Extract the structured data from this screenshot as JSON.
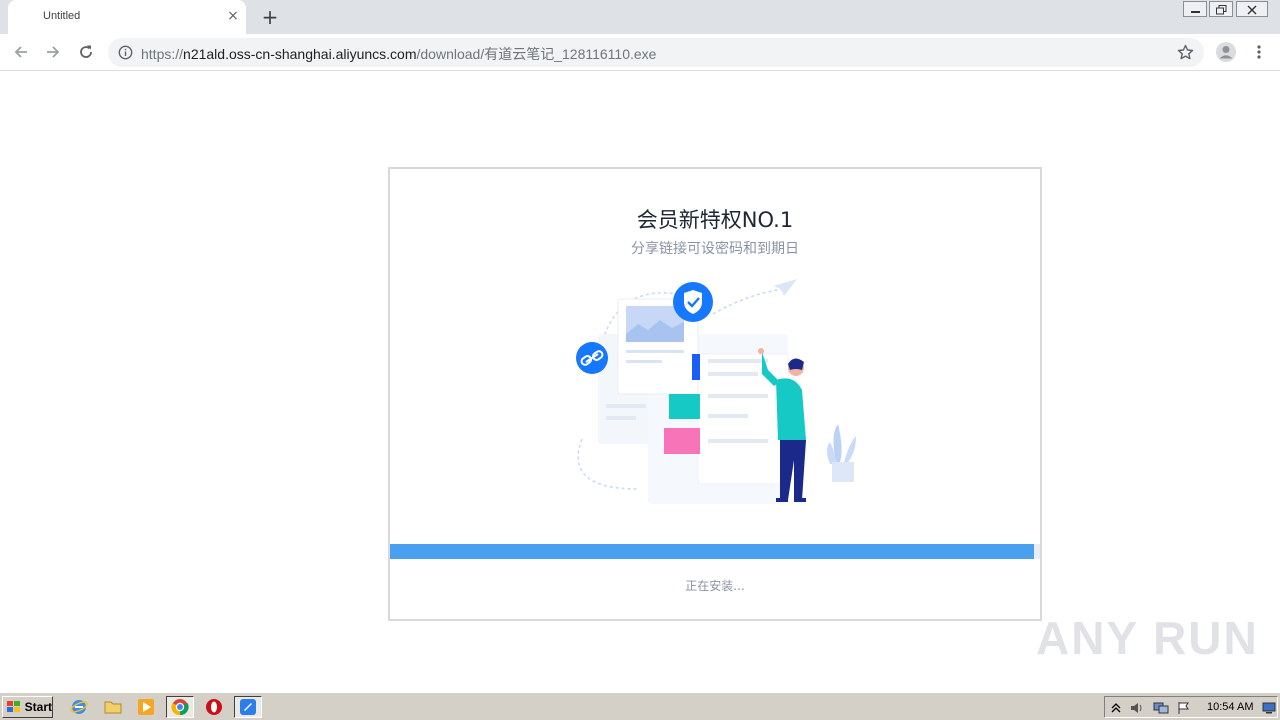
{
  "browser": {
    "tab": {
      "title": "Untitled",
      "close_glyph": "×"
    },
    "new_tab_glyph": "+",
    "address": {
      "scheme": "https://",
      "host": "n21ald.oss-cn-shanghai.aliyuncs.com",
      "path": "/download/有道云笔记_128116110.exe"
    }
  },
  "installer": {
    "title": "会员新特权NO.1",
    "subtitle": "分享链接可设密码和到期日",
    "progress_percent": 99,
    "status": "正在安装...",
    "colors": {
      "accent": "#4a9ff1",
      "shield": "#1677ff",
      "teal": "#17c9c4",
      "pink": "#f774b8",
      "navy": "#1b2a8a"
    }
  },
  "watermark": {
    "text": "ANY RUN"
  },
  "taskbar": {
    "start_label": "Start",
    "quick_launch": [
      "internet-explorer-icon",
      "folder-icon",
      "media-player-icon",
      "chrome-icon",
      "opera-icon",
      "installer-app-icon"
    ],
    "clock": "10:54 AM"
  }
}
